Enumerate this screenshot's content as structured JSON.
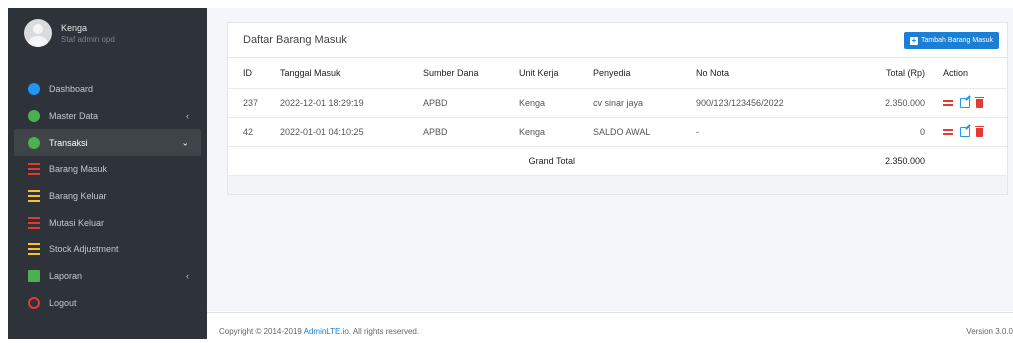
{
  "user": {
    "name": "Kenga",
    "subtitle": "Staf admin opd"
  },
  "sidebar": {
    "items": [
      {
        "label": "Dashboard",
        "icon": "dashboard-icon",
        "color": "#2196f3",
        "chevron": ""
      },
      {
        "label": "Master Data",
        "icon": "gear-icon",
        "color": "#4caf50",
        "chevron": "‹"
      },
      {
        "label": "Transaksi",
        "icon": "gear-icon",
        "color": "#4caf50",
        "chevron": "⌄",
        "active": true
      },
      {
        "label": "Barang Masuk",
        "icon": "list-icon",
        "color": "#e53935",
        "chevron": ""
      },
      {
        "label": "Barang Keluar",
        "icon": "list-icon",
        "color": "#fbc02d",
        "chevron": ""
      },
      {
        "label": "Mutasi Keluar",
        "icon": "list-icon",
        "color": "#e53935",
        "chevron": ""
      },
      {
        "label": "Stock Adjustment",
        "icon": "list-icon",
        "color": "#fbc02d",
        "chevron": ""
      },
      {
        "label": "Laporan",
        "icon": "report-icon",
        "color": "#4caf50",
        "chevron": "‹"
      },
      {
        "label": "Logout",
        "icon": "power-icon",
        "color": "#e53935",
        "chevron": ""
      }
    ]
  },
  "card": {
    "title": "Daftar Barang Masuk",
    "add_button": "Tambah Barang Masuk"
  },
  "table": {
    "headers": [
      "ID",
      "Tanggal Masuk",
      "Sumber Dana",
      "Unit Kerja",
      "Penyedia",
      "No Nota",
      "Total (Rp)",
      "Action"
    ],
    "rows": [
      [
        "237",
        "2022-12-01 18:29:19",
        "APBD",
        "Kenga",
        "cv sinar jaya",
        "900/123/123456/2022",
        "2.350.000"
      ],
      [
        "42",
        "2022-01-01 04:10:25",
        "APBD",
        "Kenga",
        "SALDO AWAL",
        "-",
        "0"
      ]
    ],
    "grand_total_label": "Grand Total",
    "grand_total_value": "2.350.000"
  },
  "footer": {
    "copyright_prefix": "Copyright © 2014-2019 ",
    "link": "AdminLTE.io",
    "suffix": ". All rights reserved.",
    "version": "Version 3.0.0"
  },
  "colors": {
    "sidebar_bg": "#2d3338",
    "accent": "#1b7fd6",
    "danger": "#e53935"
  }
}
